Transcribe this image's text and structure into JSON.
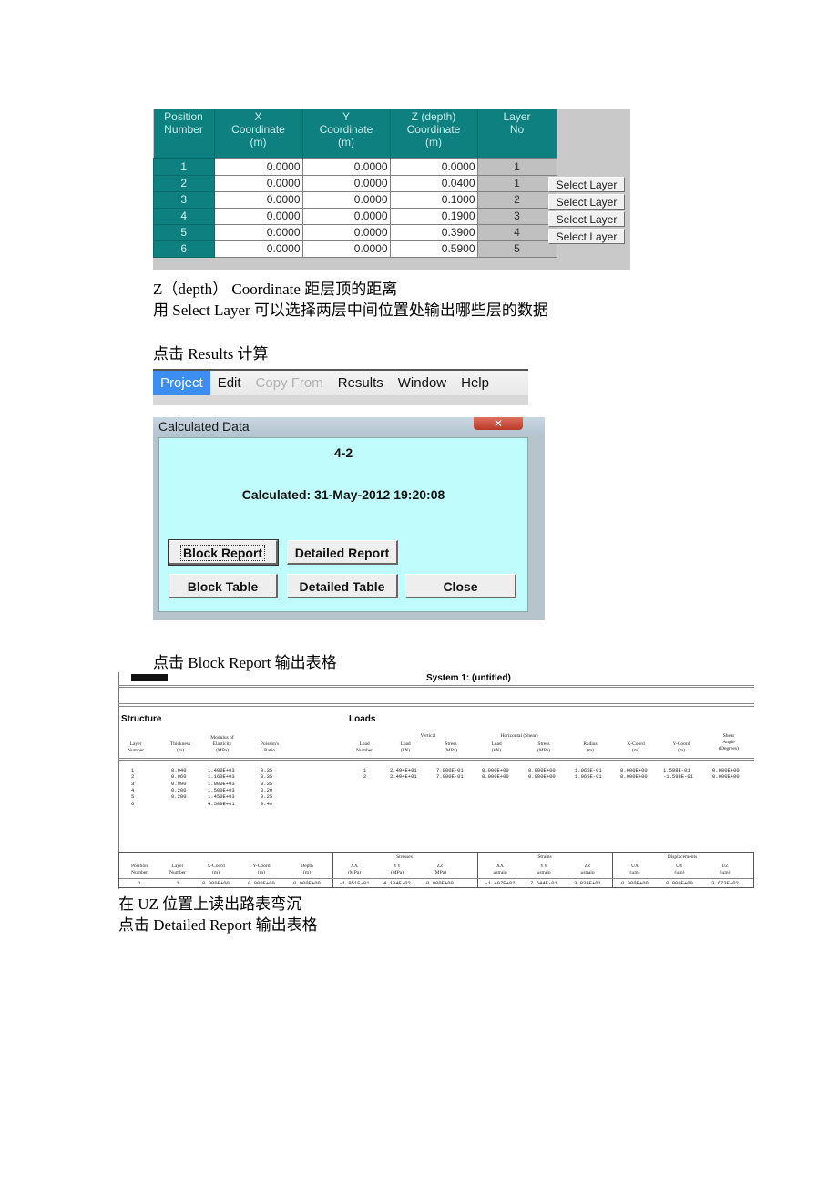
{
  "position_grid": {
    "headers": [
      "Position\nNumber",
      "X\nCoordinate\n(m)",
      "Y\nCoordinate\n(m)",
      "Z (depth)\nCoordinate\n(m)",
      "Layer\nNo"
    ],
    "rows": [
      {
        "pos": "1",
        "x": "0.0000",
        "y": "0.0000",
        "z": "0.0000",
        "layer": "1"
      },
      {
        "pos": "2",
        "x": "0.0000",
        "y": "0.0000",
        "z": "0.0400",
        "layer": "1"
      },
      {
        "pos": "3",
        "x": "0.0000",
        "y": "0.0000",
        "z": "0.1000",
        "layer": "2"
      },
      {
        "pos": "4",
        "x": "0.0000",
        "y": "0.0000",
        "z": "0.1900",
        "layer": "3"
      },
      {
        "pos": "5",
        "x": "0.0000",
        "y": "0.0000",
        "z": "0.3900",
        "layer": "4"
      },
      {
        "pos": "6",
        "x": "0.0000",
        "y": "0.0000",
        "z": "0.5900",
        "layer": "5"
      }
    ],
    "select_layer_label": "Select Layer"
  },
  "text": {
    "line1": "Z（depth）  Coordinate  距层顶的距离",
    "line2": "用 Select Layer 可以选择两层中间位置处输出哪些层的数据",
    "line3": "点击 Results 计算",
    "line4": "点击 Block Report 输出表格",
    "line5": "在 UZ 位置上读出路表弯沉",
    "line6": "点击 Detailed Report 输出表格"
  },
  "menu": {
    "items": [
      "Project",
      "Edit",
      "Copy From",
      "Results",
      "Window",
      "Help"
    ],
    "active": "Project",
    "disabled": "Copy From"
  },
  "dialog": {
    "title": "Calculated Data",
    "close_glyph": "✕",
    "project_name": "4-2",
    "calculated": "Calculated: 31-May-2012 19:20:08",
    "buttons": {
      "block_report": "Block Report",
      "detailed_report": "Detailed Report",
      "block_table": "Block Table",
      "detailed_table": "Detailed Table",
      "close": "Close"
    }
  },
  "report": {
    "title": "System  1: (untitled)",
    "structure_label": "Structure",
    "loads_label": "Loads",
    "structure": {
      "headers": {
        "layer": "Layer\nNumber",
        "thickness": "Thickness\n(m)",
        "modulus": "Modulus of\nElasticity\n(MPa)",
        "poisson": "Poisson's\nRatio"
      },
      "rows": [
        {
          "layer": "1",
          "thickness": "0.040",
          "modulus": "1.400E+03",
          "poisson": "0.35"
        },
        {
          "layer": "2",
          "thickness": "0.060",
          "modulus": "1.160E+03",
          "poisson": "0.35"
        },
        {
          "layer": "3",
          "thickness": "0.090",
          "modulus": "1.000E+03",
          "poisson": "0.35"
        },
        {
          "layer": "4",
          "thickness": "0.200",
          "modulus": "1.500E+03",
          "poisson": "0.20"
        },
        {
          "layer": "5",
          "thickness": "0.200",
          "modulus": "1.450E+03",
          "poisson": "0.25"
        },
        {
          "layer": "6",
          "thickness": "",
          "modulus": "4.500E+01",
          "poisson": "0.40"
        }
      ]
    },
    "loads": {
      "group_vertical": "Vertical",
      "group_horizontal": "Horizontal (Shear)",
      "headers": {
        "number": "Load\nNumber",
        "v_load": "Load\n(kN)",
        "v_stress": "Stress\n(MPa)",
        "h_load": "Load\n(kN)",
        "h_stress": "Stress\n(MPa)",
        "radius": "Radius\n(m)",
        "xcoord": "X-Coord\n(m)",
        "ycoord": "Y-Coord\n(m)",
        "shear_angle": "Shear\nAngle\n(Degrees)"
      },
      "rows": [
        {
          "number": "1",
          "v_load": "2.494E+01",
          "v_stress": "7.000E-01",
          "h_load": "0.000E+00",
          "h_stress": "0.000E+00",
          "radius": "1.065E-01",
          "xcoord": "0.000E+00",
          "ycoord": "1.598E-01",
          "shear_angle": "0.000E+00"
        },
        {
          "number": "2",
          "v_load": "2.494E+01",
          "v_stress": "7.000E-01",
          "h_load": "0.000E+00",
          "h_stress": "0.000E+00",
          "radius": "1.065E-01",
          "xcoord": "0.000E+00",
          "ycoord": "-1.598E-01",
          "shear_angle": "0.000E+00"
        }
      ]
    },
    "positions": {
      "group_stresses": "Stresses",
      "group_strains": "Strains",
      "group_displacements": "Displacements",
      "headers": [
        "Position\nNumber",
        "Layer\nNumber",
        "X-Coord\n(m)",
        "Y-Coord\n(m)",
        "Depth\n(m)",
        "XX\n(MPa)",
        "YY\n(MPa)",
        "ZZ\n(MPa)",
        "XX\nμstrain",
        "YY\nμstrain",
        "ZZ\nμstrain",
        "UX\n(μm)",
        "UY\n(μm)",
        "UZ\n(μm)"
      ],
      "row": [
        "1",
        "1",
        "0.000E+00",
        "0.000E+00",
        "0.000E+00",
        "-1.951E-01",
        "4.134E-02",
        "0.000E+00",
        "-1.497E+02",
        "7.644E-01",
        "3.838E+01",
        "0.000E+00",
        "0.000E+00",
        "3.673E+02"
      ]
    }
  }
}
